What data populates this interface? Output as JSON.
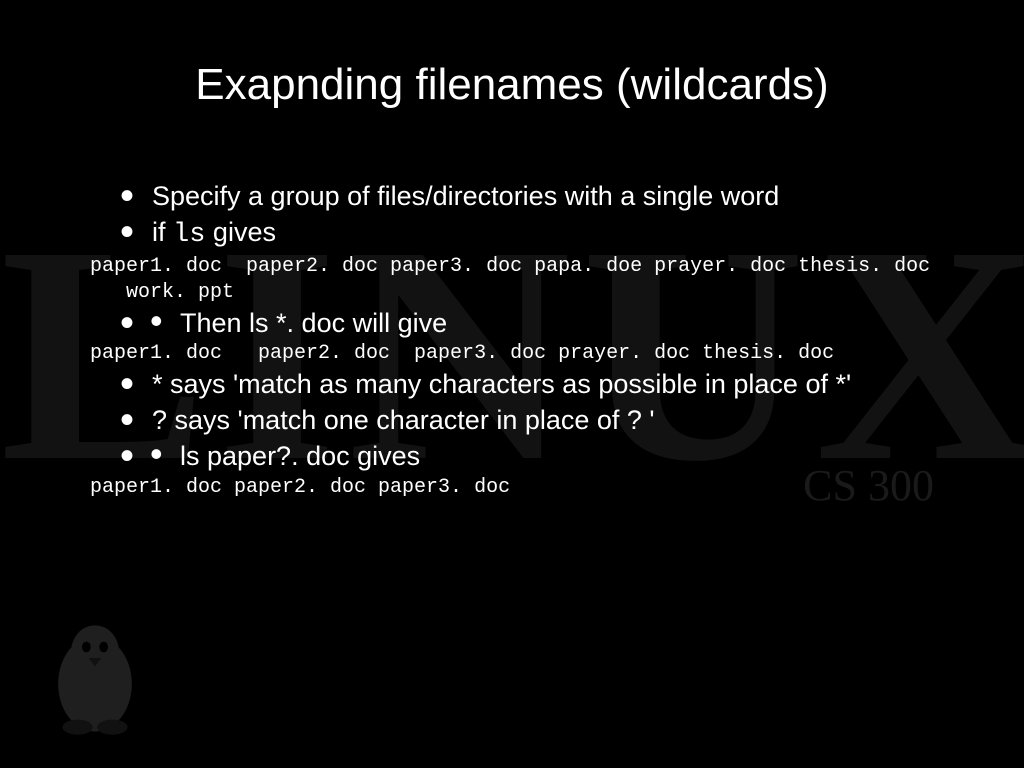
{
  "watermark": {
    "main": "LINUX",
    "sub": "CS 300"
  },
  "title": "Exapnding filenames (wildcards)",
  "bullets": {
    "b1_pre": "Specify a group of files/directories with a single word",
    "b2_pre": "if ",
    "b2_code": "ls",
    "b2_post": " gives",
    "code1_line1": "paper1. doc  paper2. doc paper3. doc papa. doe prayer. doc thesis. doc",
    "code1_line2": "   work. ppt",
    "b3": "Then ls *. doc will give",
    "code2": "paper1. doc   paper2. doc  paper3. doc prayer. doc thesis. doc",
    "b4": "*  says 'match as many characters as possible in place of *'",
    "b5": "? says 'match one character in place of ? '",
    "b6": "ls paper?. doc gives",
    "code3": "paper1. doc paper2. doc paper3. doc"
  }
}
